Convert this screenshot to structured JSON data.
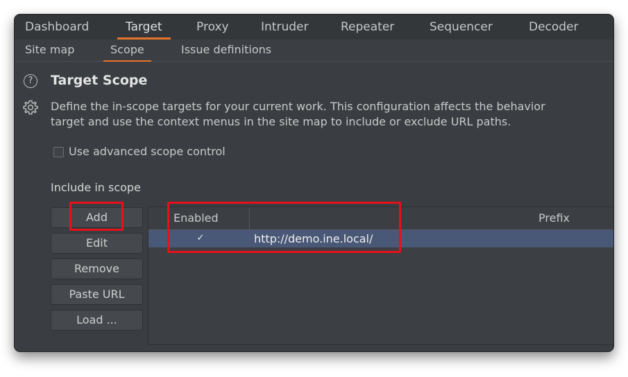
{
  "topnav": {
    "tabs": [
      {
        "label": "Dashboard"
      },
      {
        "label": "Target",
        "active": true
      },
      {
        "label": "Proxy"
      },
      {
        "label": "Intruder"
      },
      {
        "label": "Repeater"
      },
      {
        "label": "Sequencer"
      },
      {
        "label": "Decoder"
      }
    ]
  },
  "subnav": {
    "tabs": [
      {
        "label": "Site map"
      },
      {
        "label": "Scope",
        "active": true
      },
      {
        "label": "Issue definitions"
      }
    ]
  },
  "section": {
    "title": "Target Scope",
    "description_line1": "Define the in-scope targets for your current work. This configuration affects the behavior",
    "description_line2": "target and use the context menus in the site map to include or exclude URL paths.",
    "help_icon": "question-circle-icon",
    "settings_icon": "gear-icon"
  },
  "advanced": {
    "label": "Use advanced scope control",
    "checked": false
  },
  "include": {
    "label": "Include in scope",
    "buttons": {
      "add": "Add",
      "edit": "Edit",
      "remove": "Remove",
      "paste_url": "Paste URL",
      "load": "Load ..."
    },
    "table": {
      "headers": {
        "enabled": "Enabled",
        "prefix": "Prefix"
      },
      "rows": [
        {
          "enabled_mark": "✓",
          "prefix": "http://demo.ine.local/"
        }
      ]
    }
  },
  "colors": {
    "accent": "#e8742b",
    "highlight": "#e8101a",
    "selected_row": "#4a5877",
    "background": "#3a3e42"
  }
}
